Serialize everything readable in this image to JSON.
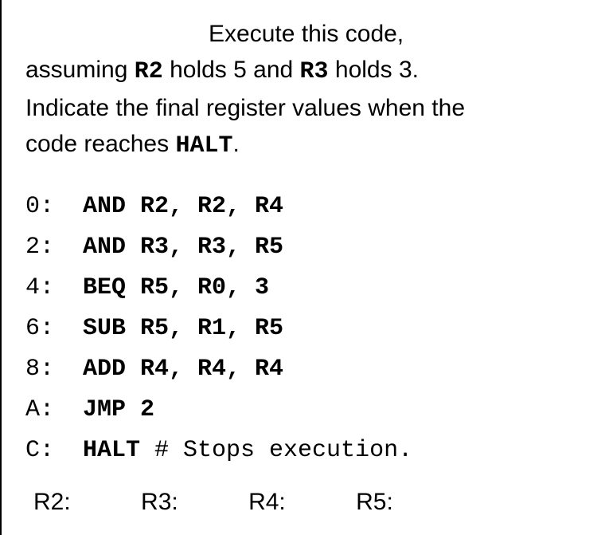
{
  "prompt": {
    "line1": "Execute this code,",
    "line2a": "assuming ",
    "r2": "R2",
    "line2b": " holds 5 and ",
    "r3": "R3",
    "line2c": " holds 3.",
    "line3": "Indicate the final register values when the",
    "line4a": "code reaches ",
    "halt": "HALT",
    "line4b": "."
  },
  "code": [
    {
      "addr": "0:",
      "instr": "AND R2, R2, R4",
      "comment": ""
    },
    {
      "addr": "2:",
      "instr": "AND R3, R3, R5",
      "comment": ""
    },
    {
      "addr": "4:",
      "instr": "BEQ R5, R0, 3",
      "comment": ""
    },
    {
      "addr": "6:",
      "instr": "SUB R5, R1, R5",
      "comment": ""
    },
    {
      "addr": "8:",
      "instr": "ADD R4, R4, R4",
      "comment": ""
    },
    {
      "addr": "A:",
      "instr": "JMP 2",
      "comment": ""
    },
    {
      "addr": "C:",
      "instr": "HALT",
      "comment": " # Stops execution."
    }
  ],
  "answers": {
    "r2_label": "R2:",
    "r3_label": "R3:",
    "r4_label": "R4:",
    "r5_label": "R5:"
  }
}
